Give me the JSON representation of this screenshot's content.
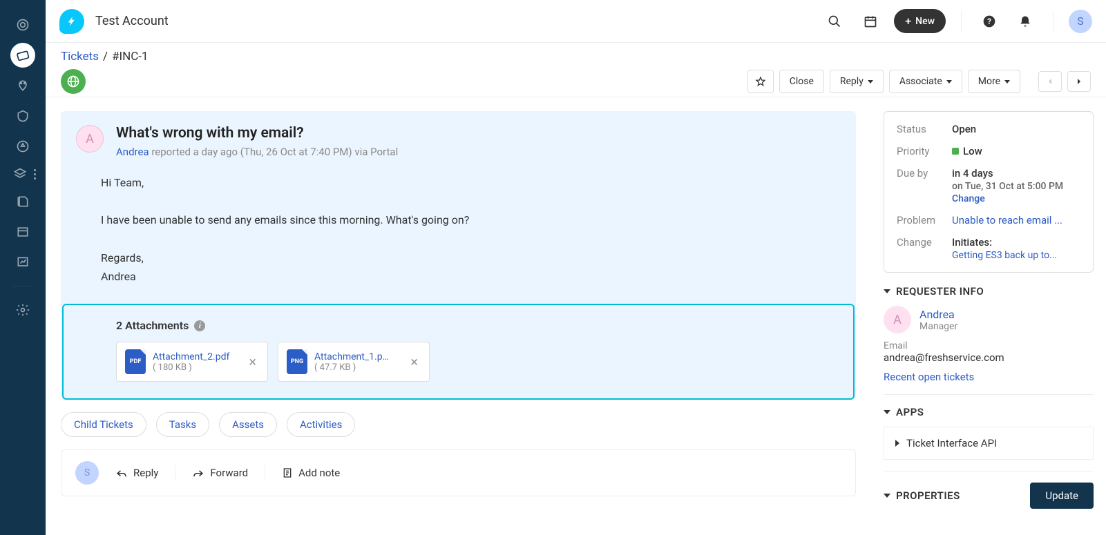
{
  "topbar": {
    "title": "Test Account",
    "new": "New",
    "avatar": "S"
  },
  "breadcrumb": {
    "tickets": "Tickets",
    "id": "#INC-1"
  },
  "actions": {
    "close": "Close",
    "reply": "Reply",
    "associate": "Associate",
    "more": "More"
  },
  "ticket": {
    "title": "What's wrong with my email?",
    "reporter": "Andrea",
    "meta": " reported a day ago (Thu, 26 Oct at 7:40 PM) via Portal",
    "avatar": "A",
    "body": {
      "greeting": "Hi Team,",
      "message": "I have been unable to send any emails since this morning. What's going on?",
      "signoff": "Regards,",
      "signature": "Andrea"
    },
    "attachments": {
      "heading": "2 Attachments",
      "items": [
        {
          "name": "Attachment_2.pdf",
          "size": "( 180 KB )",
          "type": "PDF"
        },
        {
          "name": "Attachment_1.p…",
          "size": "( 47.7 KB )",
          "type": "PNG"
        }
      ]
    }
  },
  "tabs": [
    "Child Tickets",
    "Tasks",
    "Assets",
    "Activities"
  ],
  "replybar": {
    "avatar": "S",
    "reply": "Reply",
    "forward": "Forward",
    "note": "Add note"
  },
  "sidebar": {
    "status": {
      "label": "Status",
      "value": "Open"
    },
    "priority": {
      "label": "Priority",
      "value": "Low"
    },
    "dueby": {
      "label": "Due by",
      "value": "in 4 days",
      "sub": "on Tue, 31 Oct at 5:00 PM",
      "change": "Change"
    },
    "problem": {
      "label": "Problem",
      "value": "Unable to reach email ..."
    },
    "change": {
      "label": "Change",
      "value": "Initiates:",
      "link": "Getting ES3 back up to..."
    },
    "requester": {
      "heading": "REQUESTER INFO",
      "avatar": "A",
      "name": "Andrea",
      "role": "Manager",
      "emailLbl": "Email",
      "email": "andrea@freshservice.com",
      "link": "Recent open tickets"
    },
    "apps": {
      "heading": "APPS",
      "item": "Ticket Interface API"
    },
    "properties": {
      "heading": "PROPERTIES",
      "update": "Update"
    }
  }
}
